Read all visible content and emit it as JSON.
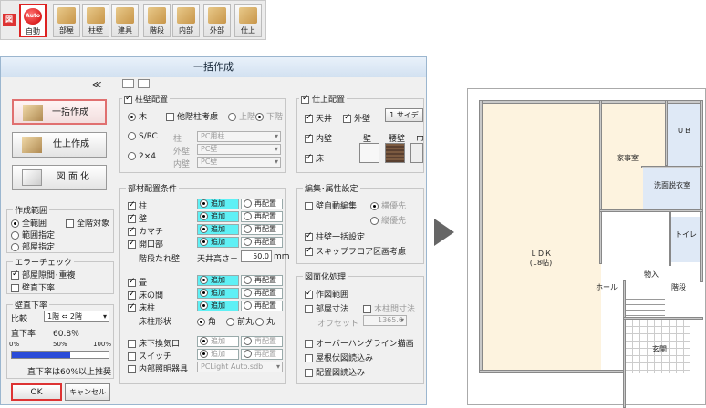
{
  "toolbar": {
    "lead_label": "図",
    "buttons": [
      {
        "label": "自動",
        "icon": "auto-icon",
        "badge": "Auto"
      },
      {
        "label": "部屋",
        "icon": "room-icon"
      },
      {
        "label": "柱壁",
        "icon": "pillar-wall-icon"
      },
      {
        "label": "建具",
        "icon": "fitting-icon"
      },
      {
        "label": "階段",
        "icon": "stairs-icon"
      },
      {
        "label": "内部",
        "icon": "interior-icon"
      },
      {
        "label": "外部",
        "icon": "exterior-icon"
      },
      {
        "label": "仕上",
        "icon": "finish-icon"
      }
    ]
  },
  "dialog": {
    "title": "一括作成",
    "collapse": "≪",
    "left": {
      "buttons": [
        "一括作成",
        "仕上作成",
        "図 面 化"
      ],
      "range": {
        "title": "作成範囲",
        "all": "全範囲",
        "all_floors": "全階対象",
        "range": "範囲指定",
        "room": "部屋指定"
      },
      "error": {
        "title": "エラーチェック",
        "gap": "部屋隙間･重複",
        "vertical": "壁直下率"
      },
      "rate": {
        "title": "壁直下率",
        "compare_label": "比較",
        "compare_value": "1階 ⇔ 2階",
        "rate_label": "直下率",
        "rate_value": "60.8％",
        "scale": [
          "0%",
          "50%",
          "100%"
        ],
        "fill": 0.608,
        "note": "直下率は60%以上推奨"
      },
      "ok": "OK",
      "cancel": "キャンセル"
    },
    "pillar": {
      "title": "柱壁配置",
      "wood": "木",
      "other_floor": "他階柱考慮",
      "upper": "上階",
      "lower": "下階",
      "src": "S/RC",
      "two_four": "2×4",
      "pillar_label": "柱",
      "pillar_value": "PC用柱",
      "outer_label": "外壁",
      "outer_value": "PC壁",
      "inner_label": "内壁",
      "inner_value": "PC壁"
    },
    "parts": {
      "title": "部材配置条件",
      "add": "追加",
      "replace": "再配置",
      "items": [
        "柱",
        "壁",
        "カマチ",
        "開口部"
      ],
      "floor_diff": "階段たれ壁",
      "ceiling_label": "天井高さ－",
      "ceiling_value": "50.0",
      "unit": "mm",
      "items2": [
        "畳",
        "床の間",
        "床柱"
      ],
      "shape_label": "床柱形状",
      "shapes": [
        "角",
        "前丸",
        "丸"
      ],
      "items3": [
        "床下換気口",
        "スイッチ",
        "内部照明器具"
      ],
      "light_value": "PCLight Auto.sdb"
    },
    "finish": {
      "title": "仕上配置",
      "ceiling": "天井",
      "outer": "外壁",
      "inner": "内壁",
      "floor": "床",
      "site": "1.サイデ",
      "wall": "壁",
      "waist": "腰壁",
      "towel": "巾"
    },
    "edit": {
      "title": "編集･属性設定",
      "auto_edit": "壁自動編集",
      "horizontal": "横優先",
      "vertical": "縦優先",
      "pillar_batch": "柱壁一括設定",
      "skip_floor": "スキップフロア区画考慮"
    },
    "drawing": {
      "title": "図面化処理",
      "range": "作図範囲",
      "room_dim": "部屋寸法",
      "wood_dim": "木柱間寸法",
      "offset_label": "オフセット",
      "offset_value": "1365.0",
      "overhang": "オーバーハングライン描画",
      "roof": "屋根伏図読込み",
      "layout": "配置図読込み"
    }
  },
  "plan": {
    "rooms": [
      {
        "name": "ＵＢ"
      },
      {
        "name": "家事室"
      },
      {
        "name": "洗面脱衣室"
      },
      {
        "name": "ＬＤＫ\n(18帖)"
      },
      {
        "name": "トイレ"
      },
      {
        "name": "物入"
      },
      {
        "name": "ホール"
      },
      {
        "name": "階段"
      },
      {
        "name": "玄関"
      }
    ]
  }
}
